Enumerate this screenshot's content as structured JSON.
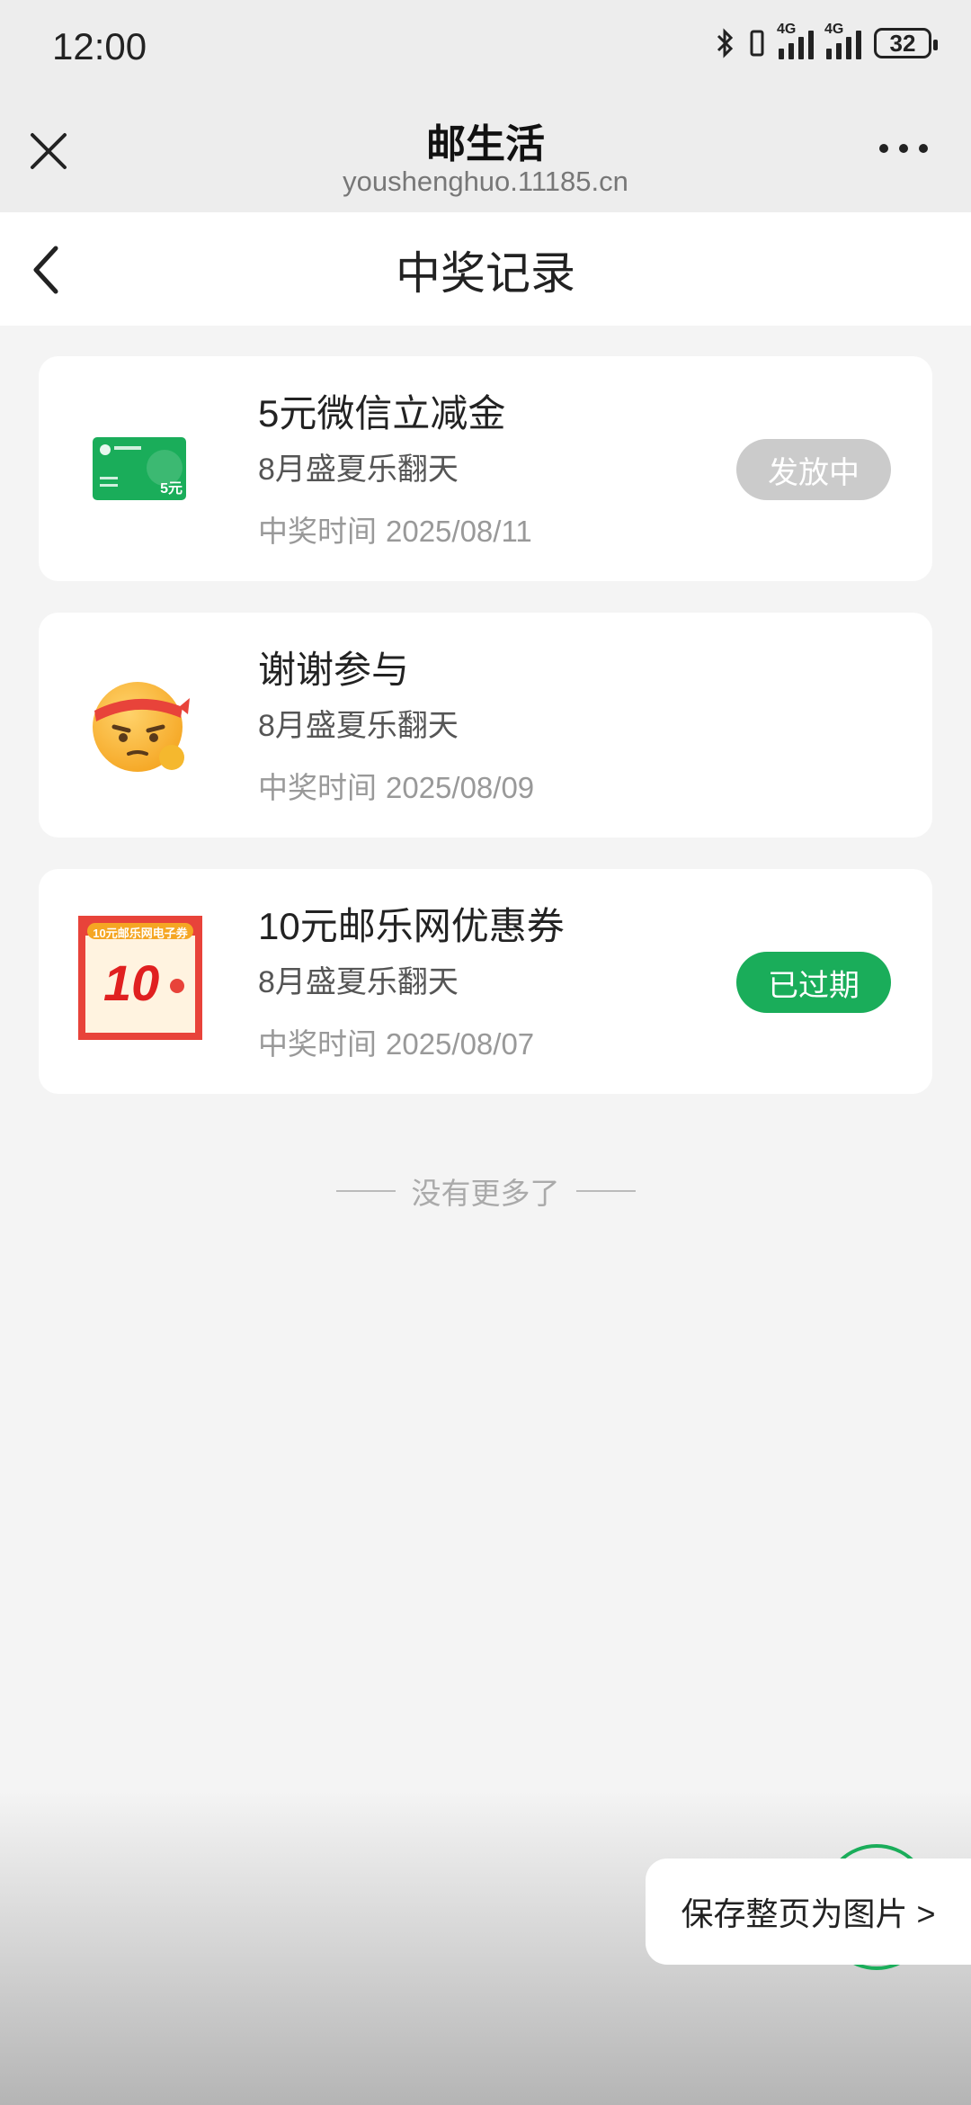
{
  "status_bar": {
    "time": "12:00",
    "network1": "4G",
    "network2": "4G",
    "battery": "32"
  },
  "browser": {
    "title": "邮生活",
    "url": "youshenghuo.11185.cn"
  },
  "page": {
    "title": "中奖记录"
  },
  "records": [
    {
      "name": "5元微信立减金",
      "event": "8月盛夏乐翻天",
      "date_label": "中奖时间",
      "date": "2025/08/11",
      "status": "发放中",
      "thumb_icon": "wechat-card-icon",
      "thumb_text": "5元"
    },
    {
      "name": "谢谢参与",
      "event": "8月盛夏乐翻天",
      "date_label": "中奖时间",
      "date": "2025/08/09",
      "status": "",
      "thumb_icon": "headband-emoji-icon"
    },
    {
      "name": "10元邮乐网优惠券",
      "event": "8月盛夏乐翻天",
      "date_label": "中奖时间",
      "date": "2025/08/07",
      "status": "已过期",
      "thumb_icon": "coupon-icon",
      "thumb_title": "10元邮乐网电子券",
      "thumb_value": "10"
    }
  ],
  "footer": {
    "no_more": "没有更多了"
  },
  "save_button": {
    "label": "保存整页为图片 >"
  },
  "colors": {
    "accent_green": "#1aad5a",
    "pending_gray": "#cbcbcb",
    "background": "#f4f4f4"
  }
}
